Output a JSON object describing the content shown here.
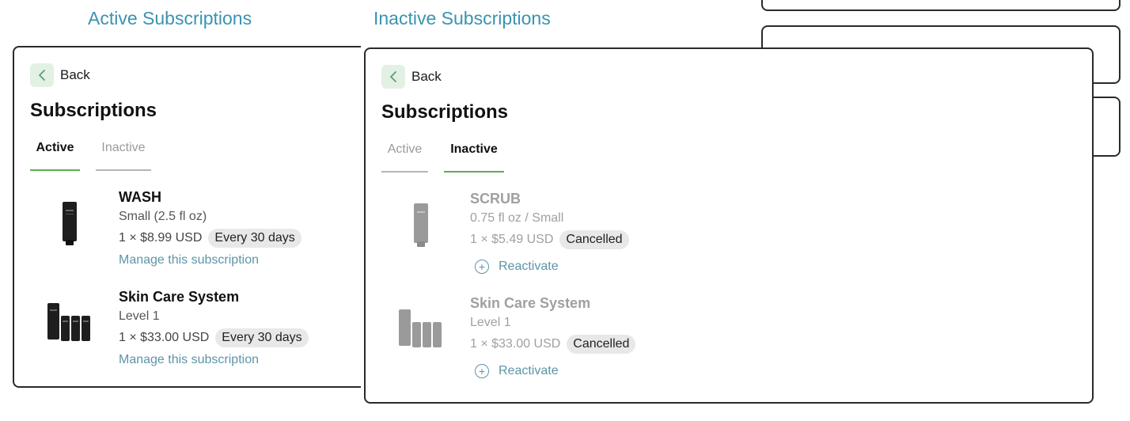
{
  "titles": {
    "active": "Active Subscriptions",
    "inactive": "Inactive Subscriptions"
  },
  "icons": {
    "back": "chevron-left-icon",
    "reactivate": "plus-circle-icon"
  },
  "colors": {
    "title": "#3a93b0",
    "accent_underline": "#5cae4f",
    "link": "#5c95a8",
    "back_bg": "#e2f1e3",
    "badge_bg": "#e8e8e8"
  },
  "active_panel": {
    "back_label": "Back",
    "heading": "Subscriptions",
    "tabs": [
      {
        "label": "Active",
        "selected": true
      },
      {
        "label": "Inactive",
        "selected": false
      }
    ],
    "items": [
      {
        "name": "WASH",
        "variant": "Small (2.5 fl oz)",
        "price": "1 × $8.99 USD",
        "badge": "Every 30 days",
        "link": "Manage this subscription"
      },
      {
        "name": "Skin Care System",
        "variant": "Level 1",
        "price": "1 × $33.00 USD",
        "badge": "Every 30 days",
        "link": "Manage this subscription"
      }
    ]
  },
  "inactive_panel": {
    "back_label": "Back",
    "heading": "Subscriptions",
    "tabs": [
      {
        "label": "Active",
        "selected": false
      },
      {
        "label": "Inactive",
        "selected": true
      }
    ],
    "items": [
      {
        "name": "SCRUB",
        "variant": "0.75 fl oz / Small",
        "price": "1 × $5.49 USD",
        "badge": "Cancelled",
        "action": "Reactivate"
      },
      {
        "name": "Skin Care System",
        "variant": "Level 1",
        "price": "1 × $33.00 USD",
        "badge": "Cancelled",
        "action": "Reactivate"
      }
    ]
  }
}
